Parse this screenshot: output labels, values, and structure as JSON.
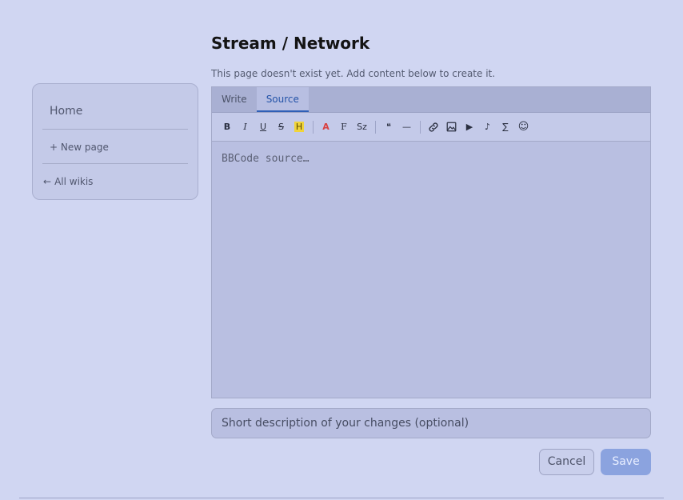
{
  "sidebar": {
    "home": "Home",
    "new_page": "+ New page",
    "all_wikis_arrow": "←",
    "all_wikis": "All wikis"
  },
  "page": {
    "title": "Stream / Network",
    "subtitle": "This page doesn't exist yet. Add content below to create it."
  },
  "editor": {
    "tabs": [
      "Write",
      "Source"
    ],
    "active_tab": "Source",
    "toolbar": {
      "bold": "B",
      "italic": "I",
      "underline": "U",
      "strike": "S",
      "highlight": "H",
      "color": "A",
      "font": "F",
      "size": "Sz",
      "quote": "❝",
      "hr": "—",
      "link_icon": "link-icon",
      "image_icon": "image-icon",
      "video": "▶",
      "audio": "♪",
      "math": "∑",
      "emoji": "☺"
    },
    "placeholder": "BBCode source…"
  },
  "description_placeholder": "Short description of your changes (optional)",
  "actions": {
    "cancel": "Cancel",
    "save": "Save"
  },
  "colors": {
    "background": "#d0d6f2",
    "accent": "#2f5fb6",
    "save_button": "#8ba3df",
    "highlight": "#f0d43a",
    "text_color_icon": "#d94040"
  }
}
